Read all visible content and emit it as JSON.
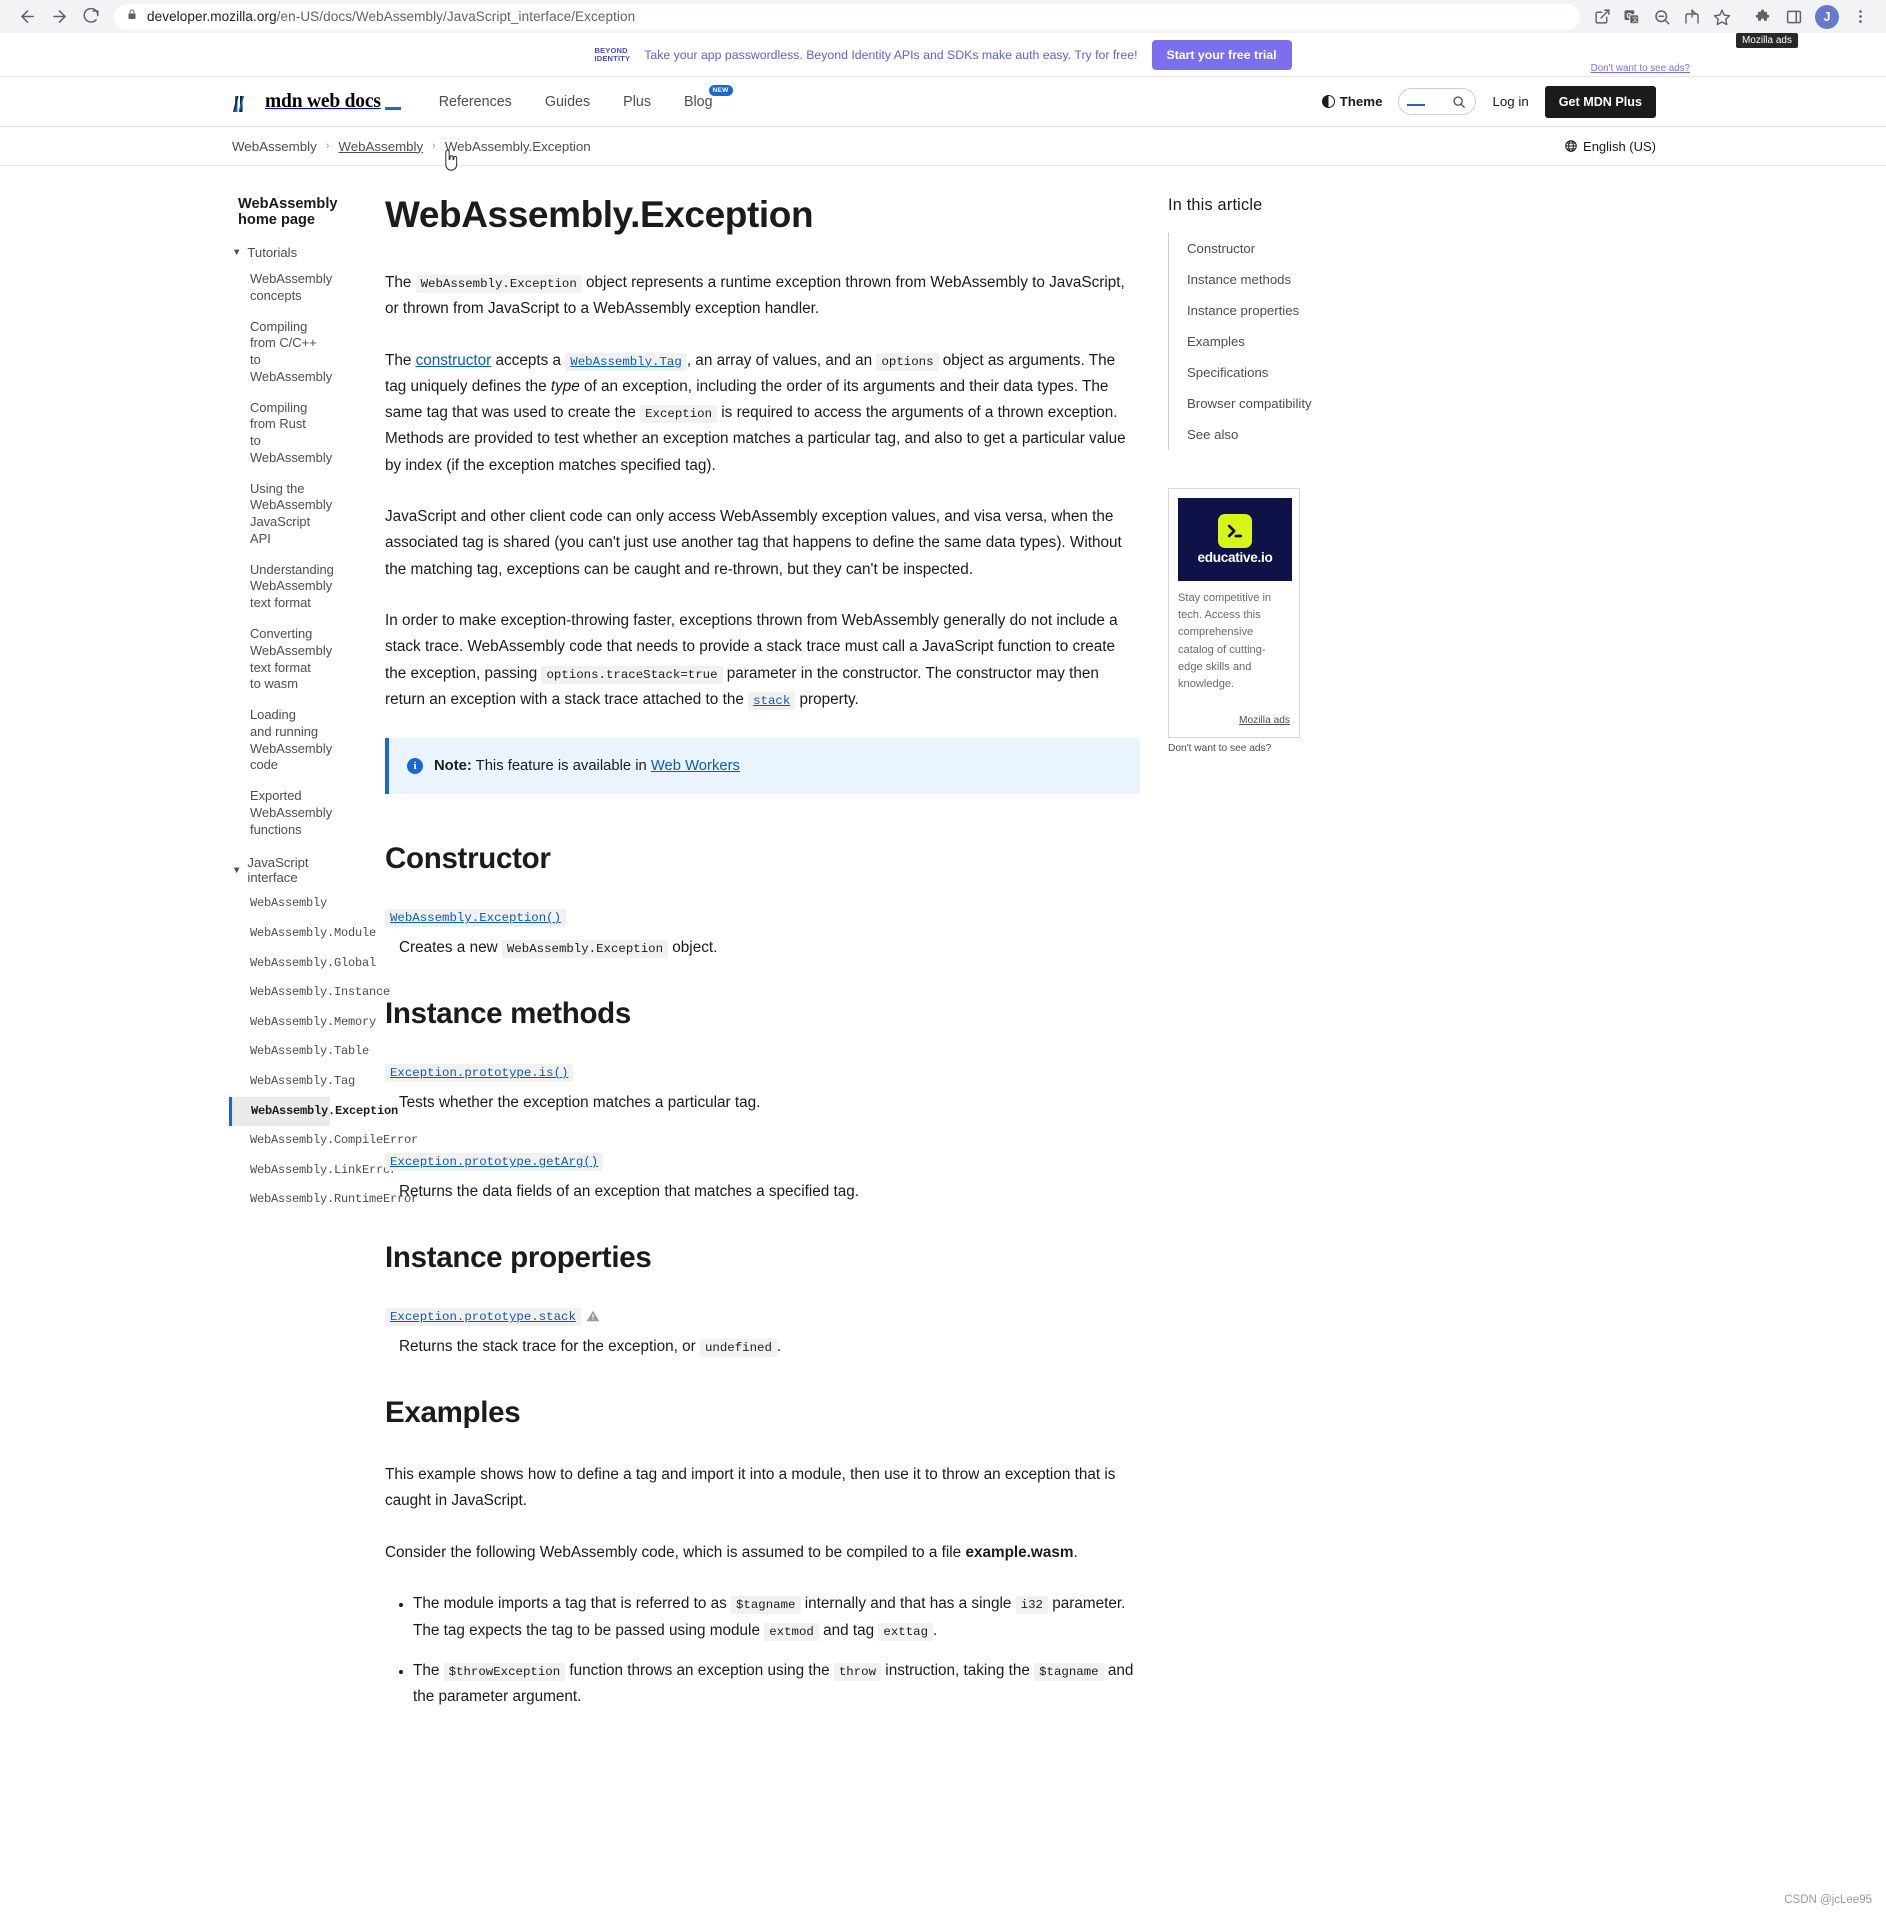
{
  "browser": {
    "back_icon": "back-arrow-icon",
    "forward_icon": "forward-arrow-icon",
    "reload_icon": "reload-icon",
    "lock_icon": "lock-icon",
    "url_domain": "developer.mozilla.org",
    "url_path": "/en-US/docs/WebAssembly/JavaScript_interface/Exception",
    "profile_initial": "J",
    "tooltip": "Mozilla ads",
    "icons": [
      "share-external-icon",
      "translate-icon",
      "zoom-out-icon",
      "share-icon",
      "bookmark-star-icon",
      "extensions-puzzle-icon",
      "side-panel-icon",
      "profile-avatar",
      "more-vertical-icon"
    ]
  },
  "promo": {
    "logo_line1": "BEYOND",
    "logo_line2": "IDENTITY",
    "text": "Take your app passwordless. Beyond Identity APIs and SDKs make auth easy. Try for free!",
    "button": "Start your free trial",
    "dismiss": "Don't want to see ads?"
  },
  "header": {
    "logo_text": "mdn web docs",
    "nav": [
      {
        "label": "References",
        "badge": ""
      },
      {
        "label": "Guides",
        "badge": ""
      },
      {
        "label": "Plus",
        "badge": ""
      },
      {
        "label": "Blog",
        "badge": "NEW"
      }
    ],
    "theme_label": "Theme",
    "search_placeholder": "",
    "login_label": "Log in",
    "plus_button": "Get MDN Plus"
  },
  "breadcrumb": {
    "items": [
      "WebAssembly",
      "WebAssembly",
      "WebAssembly.Exception"
    ],
    "separator": "›",
    "language": "English (US)"
  },
  "sidebar": {
    "home_title": "WebAssembly home page",
    "groups": [
      {
        "label": "Tutorials",
        "items": [
          "WebAssembly concepts",
          "Compiling from C/C++ to WebAssembly",
          "Compiling from Rust to WebAssembly",
          "Using the WebAssembly JavaScript API",
          "Understanding WebAssembly text format",
          "Converting WebAssembly text format to wasm",
          "Loading and running WebAssembly code",
          "Exported WebAssembly functions"
        ],
        "mono": false
      },
      {
        "label": "JavaScript interface",
        "items": [
          "WebAssembly",
          "WebAssembly.Module",
          "WebAssembly.Global",
          "WebAssembly.Instance",
          "WebAssembly.Memory",
          "WebAssembly.Table",
          "WebAssembly.Tag",
          "WebAssembly.Exception",
          "WebAssembly.CompileError",
          "WebAssembly.LinkError",
          "WebAssembly.RuntimeError"
        ],
        "mono": true,
        "active": "WebAssembly.Exception"
      }
    ]
  },
  "article": {
    "title": "WebAssembly.Exception",
    "p1_a": "The ",
    "p1_code": "WebAssembly.Exception",
    "p1_b": " object represents a runtime exception thrown from WebAssembly to JavaScript, or thrown from JavaScript to a WebAssembly exception handler.",
    "p2_a": "The ",
    "p2_link": "constructor",
    "p2_b": " accepts a ",
    "p2_code1": "WebAssembly.Tag",
    "p2_c": ", an array of values, and an ",
    "p2_code2": "options",
    "p2_d": " object as arguments. The tag uniquely defines the ",
    "p2_em": "type",
    "p2_e": " of an exception, including the order of its arguments and their data types. The same tag that was used to create the ",
    "p2_code3": "Exception",
    "p2_f": " is required to access the arguments of a thrown exception. Methods are provided to test whether an exception matches a particular tag, and also to get a particular value by index (if the exception matches specified tag).",
    "p3": "JavaScript and other client code can only access WebAssembly exception values, and visa versa, when the associated tag is shared (you can't just use another tag that happens to define the same data types). Without the matching tag, exceptions can be caught and re-thrown, but they can't be inspected.",
    "p4_a": "In order to make exception-throwing faster, exceptions thrown from WebAssembly generally do not include a stack trace. WebAssembly code that needs to provide a stack trace must call a JavaScript function to create the exception, passing ",
    "p4_code1": "options.traceStack=true",
    "p4_b": " parameter in the constructor. The constructor may then return an exception with a stack trace attached to the ",
    "p4_code2": "stack",
    "p4_c": " property.",
    "note_label": "Note:",
    "note_text": " This feature is available in ",
    "note_link": "Web Workers",
    "sections": {
      "constructor": {
        "heading": "Constructor",
        "entries": [
          {
            "term": "WebAssembly.Exception()",
            "desc_a": "Creates a new ",
            "desc_code": "WebAssembly.Exception",
            "desc_b": " object.",
            "warning": false
          }
        ]
      },
      "instance_methods": {
        "heading": "Instance methods",
        "entries": [
          {
            "term": "Exception.prototype.is()",
            "desc_a": "Tests whether the exception matches a particular tag.",
            "desc_code": "",
            "desc_b": "",
            "warning": false
          },
          {
            "term": "Exception.prototype.getArg()",
            "desc_a": "Returns the data fields of an exception that matches a specified tag.",
            "desc_code": "",
            "desc_b": "",
            "warning": false
          }
        ]
      },
      "instance_properties": {
        "heading": "Instance properties",
        "entries": [
          {
            "term": "Exception.prototype.stack",
            "desc_a": "Returns the stack trace for the exception, or ",
            "desc_code": "undefined",
            "desc_b": ".",
            "warning": true
          }
        ]
      },
      "examples": {
        "heading": "Examples",
        "p1": "This example shows how to define a tag and import it into a module, then use it to throw an exception that is caught in JavaScript.",
        "p2_a": "Consider the following WebAssembly code, which is assumed to be compiled to a file ",
        "p2_strong": "example.wasm",
        "p2_b": ".",
        "bullets": [
          {
            "a": "The module imports a tag that is referred to as ",
            "c1": "$tagname",
            "b": " internally and that has a single ",
            "c2": "i32",
            "c": " parameter. The tag expects the tag to be passed using module ",
            "c3": "extmod",
            "d": " and tag ",
            "c4": "exttag",
            "e": "."
          },
          {
            "a": "The ",
            "c1": "$throwException",
            "b": " function throws an exception using the ",
            "c2": "throw",
            "c": " instruction, taking the ",
            "c3": "$tagname",
            "d": " and the parameter argument.",
            "c4": "",
            "e": ""
          }
        ]
      }
    }
  },
  "toc": {
    "title": "In this article",
    "items": [
      "Constructor",
      "Instance methods",
      "Instance properties",
      "Examples",
      "Specifications",
      "Browser compatibility",
      "See also"
    ]
  },
  "ad": {
    "brand": "educative.io",
    "text": "Stay competitive in tech. Access this comprehensive catalog of cutting-edge skills and knowledge.",
    "source": "Mozilla ads",
    "dismiss": "Don't want to see ads?"
  },
  "watermark": "CSDN @jcLee95"
}
